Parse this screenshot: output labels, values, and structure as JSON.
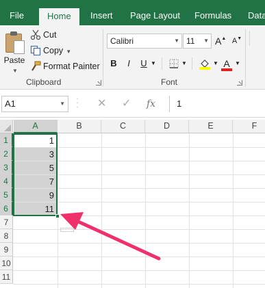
{
  "ribbon": {
    "tabs": [
      {
        "label": "File",
        "active": false
      },
      {
        "label": "Home",
        "active": true
      },
      {
        "label": "Insert",
        "active": false
      },
      {
        "label": "Page Layout",
        "active": false
      },
      {
        "label": "Formulas",
        "active": false
      },
      {
        "label": "Data",
        "active": false
      }
    ],
    "clipboard": {
      "paste_label": "Paste",
      "cut_label": "Cut",
      "copy_label": "Copy",
      "format_painter_label": "Format Painter",
      "group_label": "Clipboard"
    },
    "font": {
      "font_name": "Calibri",
      "font_size": "11",
      "grow_label": "A",
      "shrink_label": "A",
      "bold_label": "B",
      "italic_label": "I",
      "underline_label": "U",
      "font_color_label": "A",
      "group_label": "Font"
    }
  },
  "formula_bar": {
    "name_box": "A1",
    "cancel_icon": "✕",
    "enter_icon": "✓",
    "fx_label": "fx",
    "content": "1"
  },
  "sheet": {
    "columns": [
      "A",
      "B",
      "C",
      "D",
      "E",
      "F"
    ],
    "rows": [
      "1",
      "2",
      "3",
      "4",
      "5",
      "6",
      "7",
      "8",
      "9",
      "10",
      "11"
    ],
    "column_a_values": [
      "1",
      "3",
      "5",
      "7",
      "9",
      "11"
    ],
    "active_cell": "A1",
    "selected_range": "A1:A6"
  },
  "colors": {
    "brand_green": "#217346",
    "selection_fill": "#d3d3d3",
    "annotation_arrow": "#f0306a"
  }
}
